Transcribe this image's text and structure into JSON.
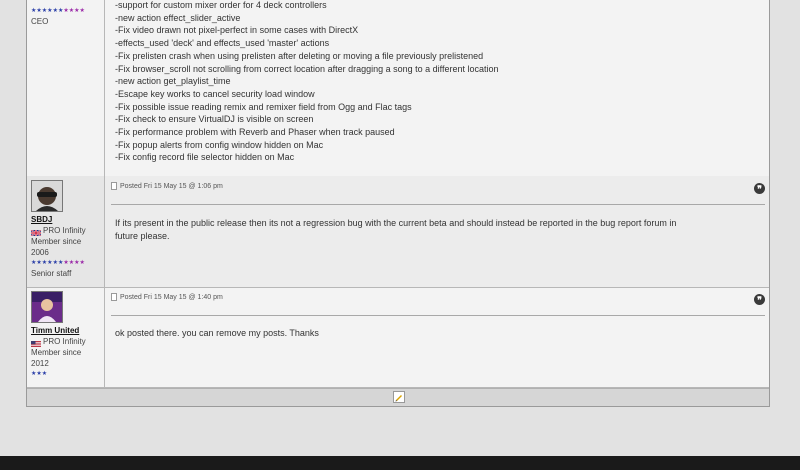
{
  "post1": {
    "author": {
      "role": "CEO",
      "stars": "★★★★★★★★★★",
      "star_colors": [
        "#2b3fa8",
        "#2b3fa8",
        "#2b3fa8",
        "#2b3fa8",
        "#2b3fa8",
        "#2b3fa8",
        "#9b2aa8",
        "#9b2aa8",
        "#9b2aa8",
        "#9b2aa8"
      ]
    },
    "lines": [
      "-support for custom mixer order for 4 deck controllers",
      "-new action effect_slider_active",
      "-Fix video drawn not pixel-perfect in some cases with DirectX",
      "-effects_used 'deck' and effects_used 'master' actions",
      "-Fix prelisten crash when using prelisten after deleting or moving a file previously prelistened",
      "-Fix browser_scroll not scrolling from correct location after dragging a song to a different location",
      "-new action get_playlist_time",
      "-Escape key works to cancel security load window",
      "-Fix possible issue reading remix and remixer field from Ogg and Flac tags",
      "-Fix check to ensure VirtualDJ is visible on screen",
      "-Fix performance problem with Reverb and Phaser when track paused",
      "-Fix popup alerts from config window hidden on Mac",
      "-Fix config record file selector hidden on Mac"
    ]
  },
  "post2": {
    "author": {
      "username": "SBDJ",
      "membership": "PRO Infinity",
      "member_since_label": "Member since",
      "member_since_year": "2006",
      "stars": "★★★★★★★★★★",
      "role": "Senior staff"
    },
    "posted": "Posted Fri 15 May 15 @ 1:06 pm",
    "body": "If its present in the public release then its not a regression bug with the current beta and should instead be reported in the bug report forum in future please."
  },
  "post3": {
    "author": {
      "username": "Timm United",
      "membership": "PRO Infinity",
      "member_since_label": "Member since",
      "member_since_year": "2012",
      "stars": "★★★"
    },
    "posted": "Posted Fri 15 May 15 @ 1:40 pm",
    "body": "ok posted there. you can remove my posts. Thanks"
  },
  "icons": {
    "quote": "quote-icon",
    "edit": "edit-icon",
    "post": "post-icon"
  },
  "colors": {
    "background": "#e2e2e2",
    "post_bg": "#f3f3f3",
    "border": "#b7b7b7",
    "star_blue": "#2b3fa8",
    "star_purple": "#9b2aa8"
  }
}
